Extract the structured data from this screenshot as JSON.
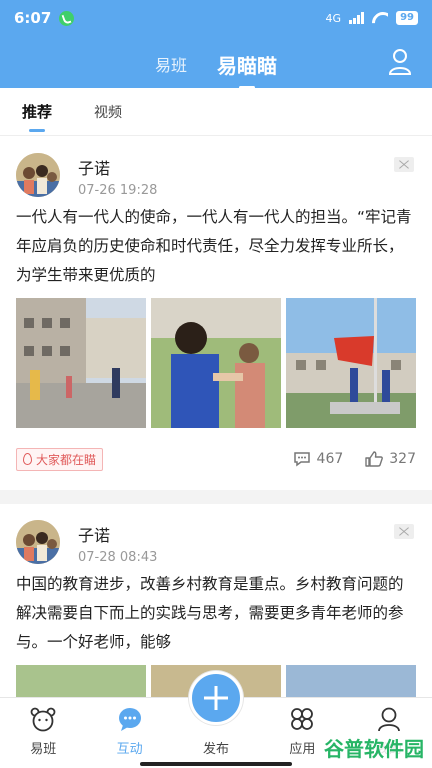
{
  "status_bar": {
    "time": "6:07",
    "network": "4G",
    "battery": "99"
  },
  "header": {
    "tabs": [
      {
        "label": "易班",
        "active": false
      },
      {
        "label": "易瞄瞄",
        "active": true
      }
    ]
  },
  "sub_tabs": [
    {
      "label": "推荐",
      "active": true
    },
    {
      "label": "视频",
      "active": false
    }
  ],
  "posts": [
    {
      "author": "子诺",
      "date": "07-26 19:28",
      "text": "一代人有一代人的使命，一代人有一代人的担当。“牢记青年应肩负的历史使命和时代责任，尽全力发挥专业所长，为学生带来更优质的",
      "tag": "大家都在瞄",
      "comments": "467",
      "likes": "327"
    },
    {
      "author": "子诺",
      "date": "07-28 08:43",
      "text": "中国的教育进步，改善乡村教育是重点。乡村教育问题的解决需要自下而上的实践与思考，需要更多青年老师的参与。一个好老师，能够"
    }
  ],
  "bottom_nav": [
    {
      "label": "易班",
      "icon": "bear-icon"
    },
    {
      "label": "互动",
      "icon": "chat-icon",
      "active": true
    },
    {
      "label": "发布",
      "icon": "plus-icon"
    },
    {
      "label": "应用",
      "icon": "apps-icon"
    },
    {
      "label": "我的",
      "icon": "person-icon"
    }
  ],
  "watermark": "谷普软件园",
  "colors": {
    "accent": "#5ba8ef",
    "hot": "#e05a5a",
    "watermark": "#27b566"
  }
}
